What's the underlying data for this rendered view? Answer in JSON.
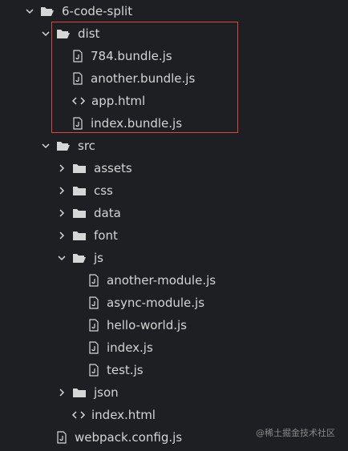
{
  "colors": {
    "background": "#1e1f22",
    "text": "#d4d4d4",
    "icon": "#d6d6d6",
    "highlight_border": "#dd4444",
    "watermark": "#8b8b8b"
  },
  "tree": {
    "root_label": "6-code-split",
    "dist_label": "dist",
    "dist_files": [
      {
        "label": "784.bundle.js",
        "icon": "js-file-icon"
      },
      {
        "label": "another.bundle.js",
        "icon": "js-file-icon"
      },
      {
        "label": "app.html",
        "icon": "html-file-icon"
      },
      {
        "label": "index.bundle.js",
        "icon": "js-file-icon"
      }
    ],
    "src_label": "src",
    "src_folders": [
      {
        "label": "assets",
        "icon": "folder-icon"
      },
      {
        "label": "css",
        "icon": "folder-icon"
      },
      {
        "label": "data",
        "icon": "folder-icon"
      },
      {
        "label": "font",
        "icon": "folder-icon"
      }
    ],
    "js_label": "js",
    "js_files": [
      {
        "label": "another-module.js",
        "icon": "js-file-icon"
      },
      {
        "label": "async-module.js",
        "icon": "js-file-icon"
      },
      {
        "label": "hello-world.js",
        "icon": "js-file-icon"
      },
      {
        "label": "index.js",
        "icon": "js-file-icon"
      },
      {
        "label": "test.js",
        "icon": "js-file-icon"
      }
    ],
    "json_label": "json",
    "src_index_html": "index.html",
    "webpack_config": "webpack.config.js"
  },
  "watermark": "@稀土掘金技术社区"
}
